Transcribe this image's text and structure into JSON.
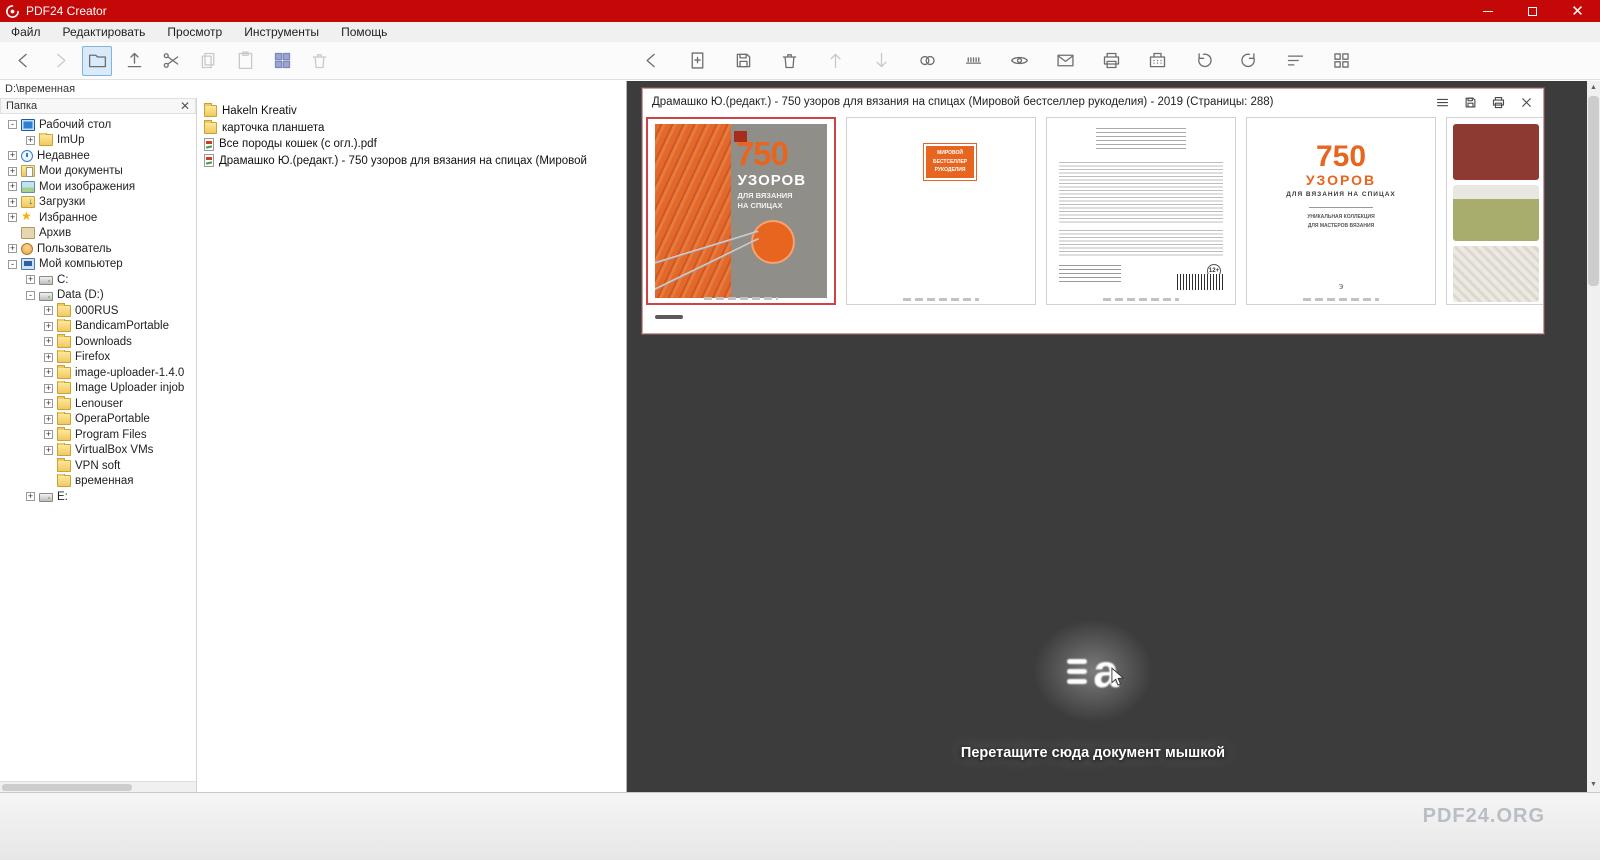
{
  "colors": {
    "titlebar_red": "#c40808",
    "selection_red": "#cc4444",
    "book_orange": "#e8651f",
    "panel_dark": "#3c3c3c",
    "preview_border": "#cf9d9d"
  },
  "window": {
    "title": "PDF24 Creator",
    "controls": [
      "minimize",
      "maximize",
      "close"
    ]
  },
  "menubar": {
    "items": [
      "Файл",
      "Редактировать",
      "Просмотр",
      "Инструменты",
      "Помощь"
    ]
  },
  "explorer_toolbar": {
    "buttons": [
      "back",
      "forward",
      "folder-view",
      "upload",
      "cut",
      "copy",
      "paste",
      "tiles-view",
      "delete"
    ]
  },
  "doc_toolbar": {
    "buttons": [
      "back",
      "add-page",
      "save",
      "delete",
      "move-up",
      "move-down",
      "merge",
      "split",
      "preview",
      "email",
      "print",
      "fax",
      "rotate-left",
      "rotate-right",
      "sort",
      "grid-view"
    ]
  },
  "explorer": {
    "path": "D:\\временная",
    "panel_title": "Папка",
    "tree": [
      {
        "label": "Рабочий стол",
        "level": 0,
        "sign": "-",
        "icon": "desktop"
      },
      {
        "label": "ImUp",
        "level": 1,
        "sign": "+",
        "icon": "folder"
      },
      {
        "label": "Недавнее",
        "level": 0,
        "sign": "+",
        "icon": "clock"
      },
      {
        "label": "Мои документы",
        "level": 0,
        "sign": "+",
        "icon": "docs"
      },
      {
        "label": "Мои изображения",
        "level": 0,
        "sign": "+",
        "icon": "images"
      },
      {
        "label": "Загрузки",
        "level": 0,
        "sign": "+",
        "icon": "downloads"
      },
      {
        "label": "Избранное",
        "level": 0,
        "sign": "+",
        "icon": "star"
      },
      {
        "label": "Архив",
        "level": 0,
        "sign": "",
        "icon": "archive"
      },
      {
        "label": "Пользователь",
        "level": 0,
        "sign": "+",
        "icon": "user"
      },
      {
        "label": "Мой компьютер",
        "level": 0,
        "sign": "-",
        "icon": "computer"
      },
      {
        "label": "C:",
        "level": 1,
        "sign": "+",
        "icon": "disk"
      },
      {
        "label": "Data (D:)",
        "level": 1,
        "sign": "-",
        "icon": "disk"
      },
      {
        "label": "000RUS",
        "level": 2,
        "sign": "+",
        "icon": "folder"
      },
      {
        "label": "BandicamPortable",
        "level": 2,
        "sign": "+",
        "icon": "folder"
      },
      {
        "label": "Downloads",
        "level": 2,
        "sign": "+",
        "icon": "folder"
      },
      {
        "label": "Firefox",
        "level": 2,
        "sign": "+",
        "icon": "folder"
      },
      {
        "label": "image-uploader-1.4.0",
        "level": 2,
        "sign": "+",
        "icon": "folder"
      },
      {
        "label": "Image Uploader injob",
        "level": 2,
        "sign": "+",
        "icon": "folder"
      },
      {
        "label": "Lenouser",
        "level": 2,
        "sign": "+",
        "icon": "folder"
      },
      {
        "label": "OperaPortable",
        "level": 2,
        "sign": "+",
        "icon": "folder"
      },
      {
        "label": "Program Files",
        "level": 2,
        "sign": "+",
        "icon": "folder"
      },
      {
        "label": "VirtualBox VMs",
        "level": 2,
        "sign": "+",
        "icon": "folder"
      },
      {
        "label": "VPN soft",
        "level": 2,
        "sign": "",
        "icon": "folder"
      },
      {
        "label": "временная",
        "level": 2,
        "sign": "",
        "icon": "folder"
      },
      {
        "label": "E:",
        "level": 1,
        "sign": "+",
        "icon": "disk"
      }
    ]
  },
  "files": {
    "items": [
      {
        "name": "Hakeln Kreativ",
        "icon": "folder"
      },
      {
        "name": "карточка планшета",
        "icon": "folder"
      },
      {
        "name": "Все породы кошек (с огл.).pdf",
        "icon": "pdf"
      },
      {
        "name": "Драмашко Ю.(редакт.) - 750 узоров для вязания на спицах (Мировой",
        "icon": "pdf"
      }
    ]
  },
  "document": {
    "title": "Драмашко Ю.(редакт.) - 750 узоров для вязания на спицах (Мировой бестселлер рукоделия) - 2019 (Страницы: 288)",
    "header_icons": [
      "menu",
      "save",
      "print",
      "close"
    ],
    "cover": {
      "big": "750",
      "t1": "УЗОРОВ",
      "t2": "ДЛЯ ВЯЗАНИЯ",
      "t3": "НА СПИЦАХ"
    },
    "page2": {
      "b1": "МИРОВОЙ",
      "b2": "БЕСТСЕЛЛЕР",
      "b3": "РУКОДЕЛИЯ"
    },
    "page3": {
      "age": "12+"
    },
    "page4": {
      "big": "750",
      "t1": "УЗОРОВ",
      "t2": "ДЛЯ ВЯЗАНИЯ НА СПИЦАХ",
      "s1": "УНИКАЛЬНАЯ КОЛЛЕКЦИЯ",
      "s2": "ДЛЯ МАСТЕРОВ ВЯЗАНИЯ",
      "pub": "э"
    }
  },
  "dropzone": {
    "text": "Перетащите сюда документ мышкой"
  },
  "footer": {
    "watermark": "PDF24.ORG"
  }
}
